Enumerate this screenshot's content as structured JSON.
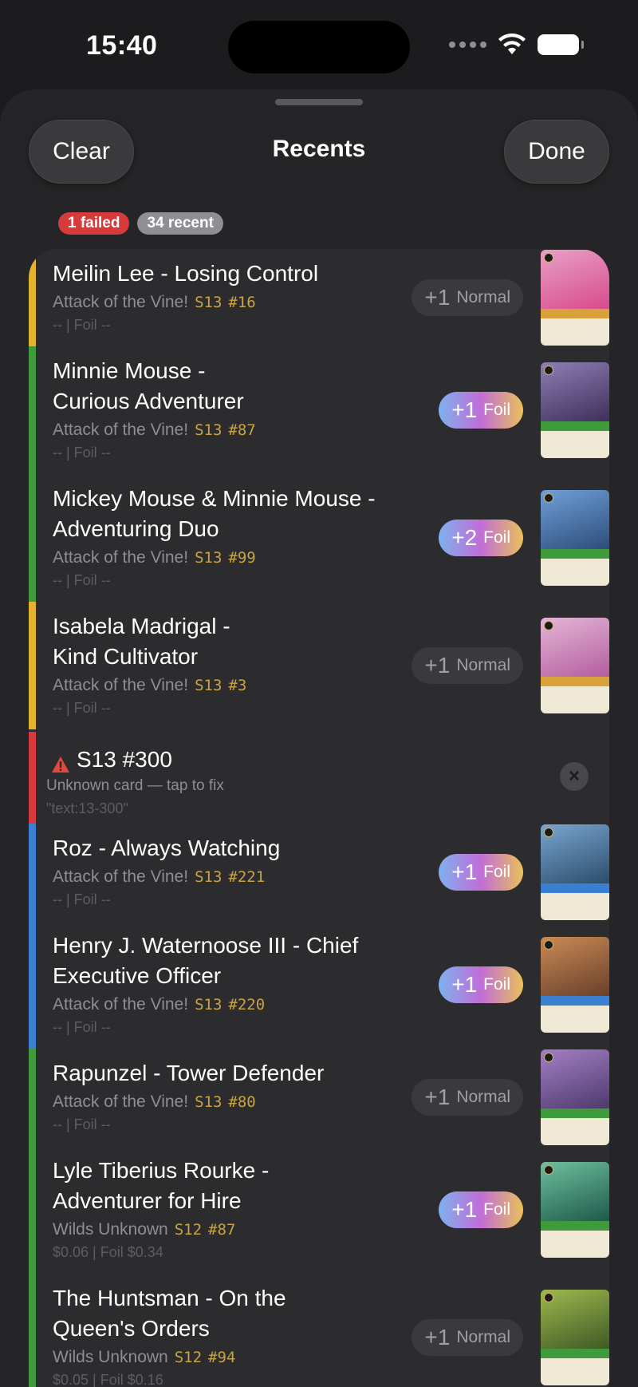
{
  "status_bar": {
    "time": "15:40"
  },
  "header": {
    "title": "Recents",
    "clear_label": "Clear",
    "done_label": "Done"
  },
  "badges": {
    "failed": "1 failed",
    "recent": "34 recent"
  },
  "colors": {
    "yellow": "#e5b32b",
    "green": "#3f9a3c",
    "red": "#d63a3a",
    "blue": "#3a7fd0"
  },
  "rows": [
    {
      "name_line1": "Meilin Lee - Losing Control",
      "name_line2": "",
      "set": "Attack of the Vine!",
      "code": "S13",
      "num": "#16",
      "price": "-- | Foil --",
      "qty": "+1",
      "kind": "Normal",
      "ink": "yellow"
    },
    {
      "name_line1": "Minnie Mouse -",
      "name_line2": "Curious Adventurer",
      "set": "Attack of the Vine!",
      "code": "S13",
      "num": "#87",
      "price": "-- | Foil --",
      "qty": "+1",
      "kind": "Foil",
      "ink": "green"
    },
    {
      "name_line1": "Mickey Mouse & Minnie Mouse -",
      "name_line2": "Adventuring Duo",
      "set": "Attack of the Vine!",
      "code": "S13",
      "num": "#99",
      "price": "-- | Foil --",
      "qty": "+2",
      "kind": "Foil",
      "ink": "green"
    },
    {
      "name_line1": "Isabela Madrigal -",
      "name_line2": "Kind Cultivator",
      "set": "Attack of the Vine!",
      "code": "S13",
      "num": "#3",
      "price": "-- | Foil --",
      "qty": "+1",
      "kind": "Normal",
      "ink": "yellow"
    },
    {
      "name_line1": "Roz - Always Watching",
      "name_line2": "",
      "set": "Attack of the Vine!",
      "code": "S13",
      "num": "#221",
      "price": "-- | Foil --",
      "qty": "+1",
      "kind": "Foil",
      "ink": "blue"
    },
    {
      "name_line1": "Henry J. Waternoose III - Chief",
      "name_line2": "Executive Officer",
      "set": "Attack of the Vine!",
      "code": "S13",
      "num": "#220",
      "price": "-- | Foil --",
      "qty": "+1",
      "kind": "Foil",
      "ink": "blue"
    },
    {
      "name_line1": "Rapunzel - Tower Defender",
      "name_line2": "",
      "set": "Attack of the Vine!",
      "code": "S13",
      "num": "#80",
      "price": "-- | Foil --",
      "qty": "+1",
      "kind": "Normal",
      "ink": "green"
    },
    {
      "name_line1": "Lyle Tiberius Rourke -",
      "name_line2": "Adventurer for Hire",
      "set": "Wilds Unknown",
      "code": "S12",
      "num": "#87",
      "price": "$0.06 | Foil $0.34",
      "qty": "+1",
      "kind": "Foil",
      "ink": "green"
    },
    {
      "name_line1": "The Huntsman - On the",
      "name_line2": "Queen's Orders",
      "set": "Wilds Unknown",
      "code": "S12",
      "num": "#94",
      "price": "$0.05 | Foil $0.16",
      "qty": "+1",
      "kind": "Normal",
      "ink": "green"
    }
  ],
  "failed_row": {
    "title": "S13 #300",
    "subtitle": "Unknown card — tap to fix",
    "raw": "\"text:13-300\""
  }
}
